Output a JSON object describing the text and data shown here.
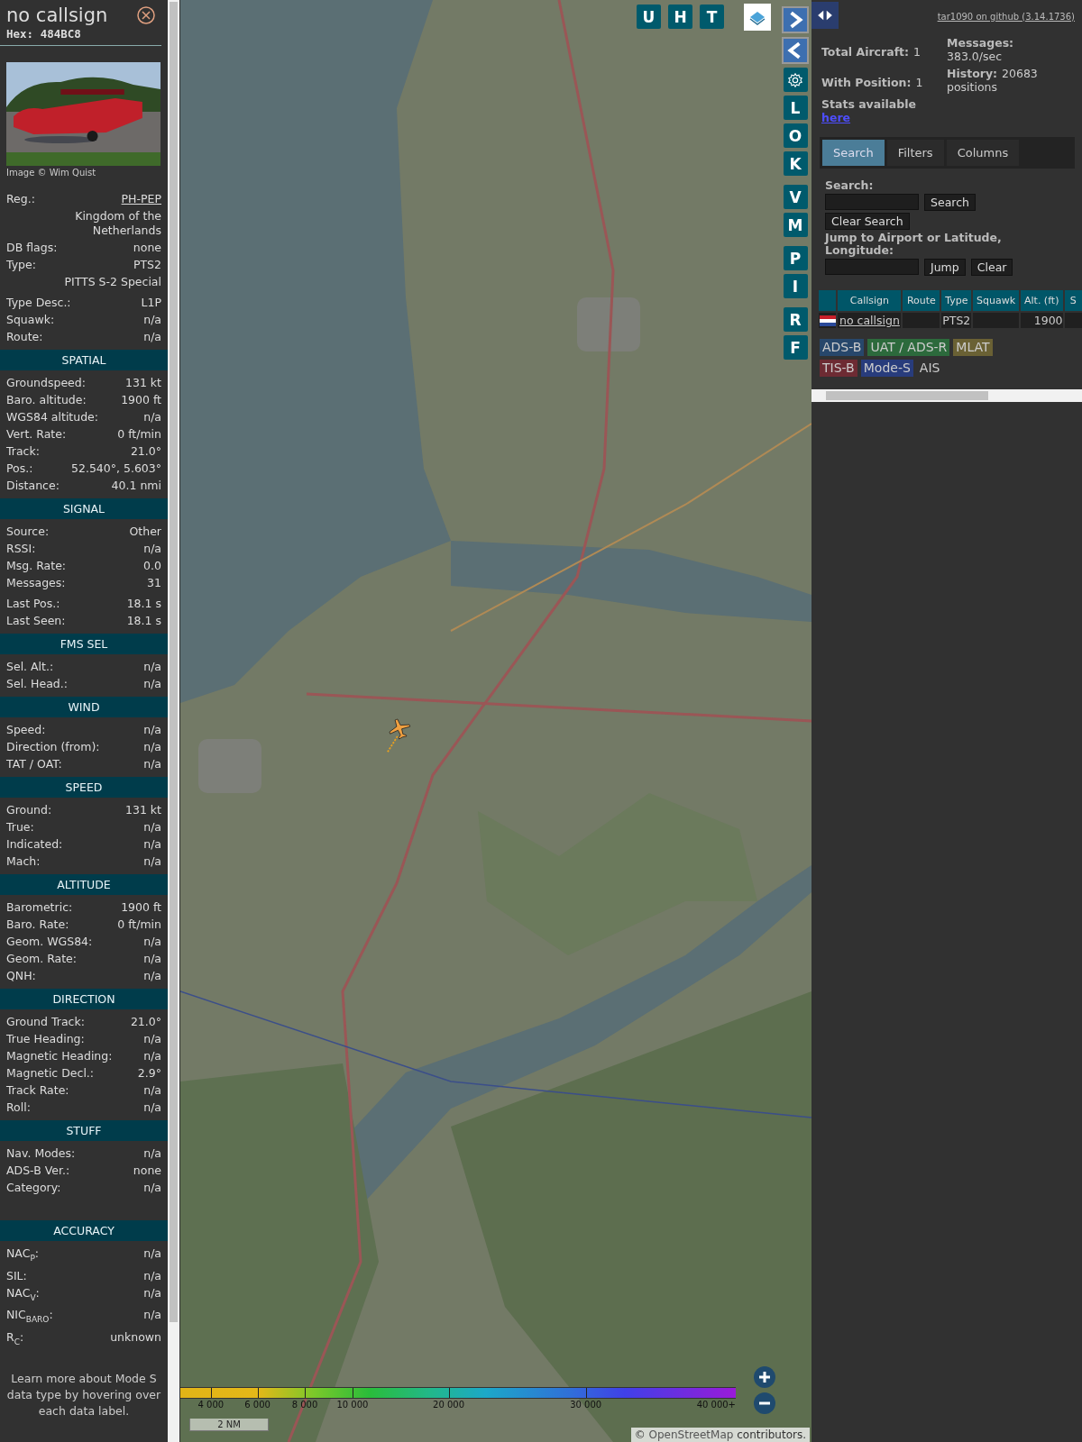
{
  "aircraft_panel": {
    "title": "no callsign",
    "hex": "Hex: 484BC8",
    "photo": {
      "kind": "picture",
      "credit": "Image © Wim Quist"
    },
    "sections": [
      {
        "groups": [
          [
            {
              "kind": "link",
              "label": "Reg.:",
              "value": "PH-PEP"
            },
            {
              "kind": "note",
              "value": "Kingdom of the Netherlands"
            },
            {
              "kind": "field",
              "label": "DB flags:",
              "value": "none"
            },
            {
              "kind": "field",
              "label": "Type:",
              "value": "PTS2"
            },
            {
              "kind": "note",
              "value": "PITTS S-2 Special"
            }
          ],
          [
            {
              "kind": "field",
              "label": "Type Desc.:",
              "value": "L1P"
            },
            {
              "kind": "field",
              "label": "Squawk:",
              "value": "n/a"
            },
            {
              "kind": "field",
              "label": "Route:",
              "value": "n/a"
            }
          ]
        ]
      },
      {
        "heading": "SPATIAL",
        "groups": [
          [
            {
              "kind": "field",
              "label": "Groundspeed:",
              "value": "131 kt"
            },
            {
              "kind": "field",
              "label": "Baro. altitude:",
              "value": "1900 ft"
            },
            {
              "kind": "field",
              "label": "WGS84 altitude:",
              "value": "n/a"
            },
            {
              "kind": "field",
              "label": "Vert. Rate:",
              "value": "0 ft/min"
            },
            {
              "kind": "field",
              "label": "Track:",
              "value": "21.0°"
            },
            {
              "kind": "field",
              "label": "Pos.:",
              "value": "52.540°, 5.603°"
            },
            {
              "kind": "field",
              "label": "Distance:",
              "value": "40.1 nmi"
            }
          ]
        ]
      },
      {
        "heading": "SIGNAL",
        "groups": [
          [
            {
              "kind": "field",
              "label": "Source:",
              "value": "Other"
            },
            {
              "kind": "field",
              "label": "RSSI:",
              "value": "n/a"
            },
            {
              "kind": "field",
              "label": "Msg. Rate:",
              "value": "0.0"
            },
            {
              "kind": "field",
              "label": "Messages:",
              "value": "31"
            }
          ],
          [
            {
              "kind": "field",
              "label": "Last Pos.:",
              "value": "18.1 s"
            },
            {
              "kind": "field",
              "label": "Last Seen:",
              "value": "18.1 s"
            }
          ]
        ]
      },
      {
        "heading": "FMS SEL",
        "groups": [
          [
            {
              "kind": "field",
              "label": "Sel. Alt.:",
              "value": "n/a"
            },
            {
              "kind": "field",
              "label": "Sel. Head.:",
              "value": "n/a"
            }
          ]
        ]
      },
      {
        "heading": "WIND",
        "groups": [
          [
            {
              "kind": "field",
              "label": "Speed:",
              "value": "n/a"
            },
            {
              "kind": "field",
              "label": "Direction (from):",
              "value": "n/a"
            },
            {
              "kind": "field",
              "label": "TAT / OAT:",
              "value": "n/a"
            }
          ]
        ]
      },
      {
        "heading": "SPEED",
        "groups": [
          [
            {
              "kind": "field",
              "label": "Ground:",
              "value": "131 kt"
            },
            {
              "kind": "field",
              "label": "True:",
              "value": "n/a"
            },
            {
              "kind": "field",
              "label": "Indicated:",
              "value": "n/a"
            },
            {
              "kind": "field",
              "label": "Mach:",
              "value": "n/a"
            }
          ]
        ]
      },
      {
        "heading": "ALTITUDE",
        "groups": [
          [
            {
              "kind": "field",
              "label": "Barometric:",
              "value": "1900 ft"
            },
            {
              "kind": "field",
              "label": "Baro. Rate:",
              "value": "0 ft/min"
            },
            {
              "kind": "field",
              "label": "Geom. WGS84:",
              "value": "n/a"
            },
            {
              "kind": "field",
              "label": "Geom. Rate:",
              "value": "n/a"
            },
            {
              "kind": "field",
              "label": "QNH:",
              "value": "n/a"
            }
          ]
        ]
      },
      {
        "heading": "DIRECTION",
        "groups": [
          [
            {
              "kind": "field",
              "label": "Ground Track:",
              "value": "21.0°"
            },
            {
              "kind": "field",
              "label": "True Heading:",
              "value": "n/a"
            },
            {
              "kind": "field",
              "label": "Magnetic Heading:",
              "value": "n/a"
            },
            {
              "kind": "field",
              "label": "Magnetic Decl.:",
              "value": "2.9°"
            },
            {
              "kind": "field",
              "label": "Track Rate:",
              "value": "n/a"
            },
            {
              "kind": "field",
              "label": "Roll:",
              "value": "n/a"
            }
          ]
        ]
      },
      {
        "heading": "STUFF",
        "groups": [
          [
            {
              "kind": "field",
              "label": "Nav. Modes:",
              "value": "n/a"
            },
            {
              "kind": "field",
              "label": "ADS-B Ver.:",
              "value": "none"
            },
            {
              "kind": "field",
              "label": "Category:",
              "value": "n/a"
            }
          ]
        ]
      },
      {
        "heading": "ACCURACY",
        "groups": [
          [
            {
              "kind": "field",
              "label": "NAC$_{P}$:",
              "value": "n/a"
            },
            {
              "kind": "field",
              "label": "SIL:",
              "value": "n/a"
            },
            {
              "kind": "field",
              "label": "NAC$_{V}$:",
              "value": "n/a"
            },
            {
              "kind": "field",
              "label": "NIC$_{BARO}$:",
              "value": "n/a"
            },
            {
              "kind": "field",
              "label": "R$_{C}$:",
              "value": "unknown"
            }
          ]
        ]
      }
    ],
    "footer": "Learn more about Mode S data type by hovering over each data label."
  },
  "map": {
    "kind": "picture",
    "view_buttons": [
      "U",
      "H",
      "T"
    ],
    "side_buttons": [
      [
        "L",
        "O",
        "K"
      ],
      [
        "V",
        "M"
      ],
      [
        "P",
        "I"
      ],
      [
        "R",
        "F"
      ]
    ],
    "altitude_legend": [
      "4 000",
      "6 000",
      "8 000",
      "10 000",
      "20 000",
      "30 000",
      "40 000+"
    ],
    "scale": "2 NM",
    "attribution": {
      "prefix": "©",
      "link": "OpenStreetMap",
      "suffix": "contributors."
    }
  },
  "side_panel": {
    "github_link": "tar1090 on github (3.14.1736)",
    "stats_left": [
      {
        "label": "Total Aircraft:",
        "value": "1"
      },
      {
        "label": "With Position:",
        "value": "1"
      }
    ],
    "stats_right": [
      {
        "label": "Messages:",
        "value": "383.0/sec"
      },
      {
        "label": "History:",
        "value": "20683 positions"
      }
    ],
    "stats_link": {
      "label": "Stats available",
      "link": "here"
    },
    "tabs": [
      {
        "label": "Search",
        "selected": true
      },
      {
        "label": "Filters",
        "selected": false
      },
      {
        "label": "Columns",
        "selected": false
      }
    ],
    "search": {
      "label": "Search:",
      "button": "Search",
      "clear_button": "Clear Search"
    },
    "jump": {
      "label": "Jump to Airport or Latitude, Longitude:",
      "button": "Jump",
      "clear_button": "Clear"
    },
    "table": {
      "columns": [
        "Callsign",
        "Route",
        "Type",
        "Squawk",
        "Alt. (ft)",
        "S"
      ],
      "rows": [
        {
          "cells": [
            "no callsign",
            null,
            "PTS2",
            null,
            "1900",
            null
          ]
        }
      ]
    },
    "source_legend": [
      {
        "label": "ADS-B",
        "color": "#27476b"
      },
      {
        "label": "UAT / ADS-R",
        "color": "#2c6a3c"
      },
      {
        "label": "MLAT",
        "color": "#6a6134"
      },
      {
        "label": "TIS-B",
        "color": "#6d2b33"
      },
      {
        "label": "Mode-S",
        "color": "#283c7c"
      },
      {
        "label": "AIS"
      }
    ]
  }
}
